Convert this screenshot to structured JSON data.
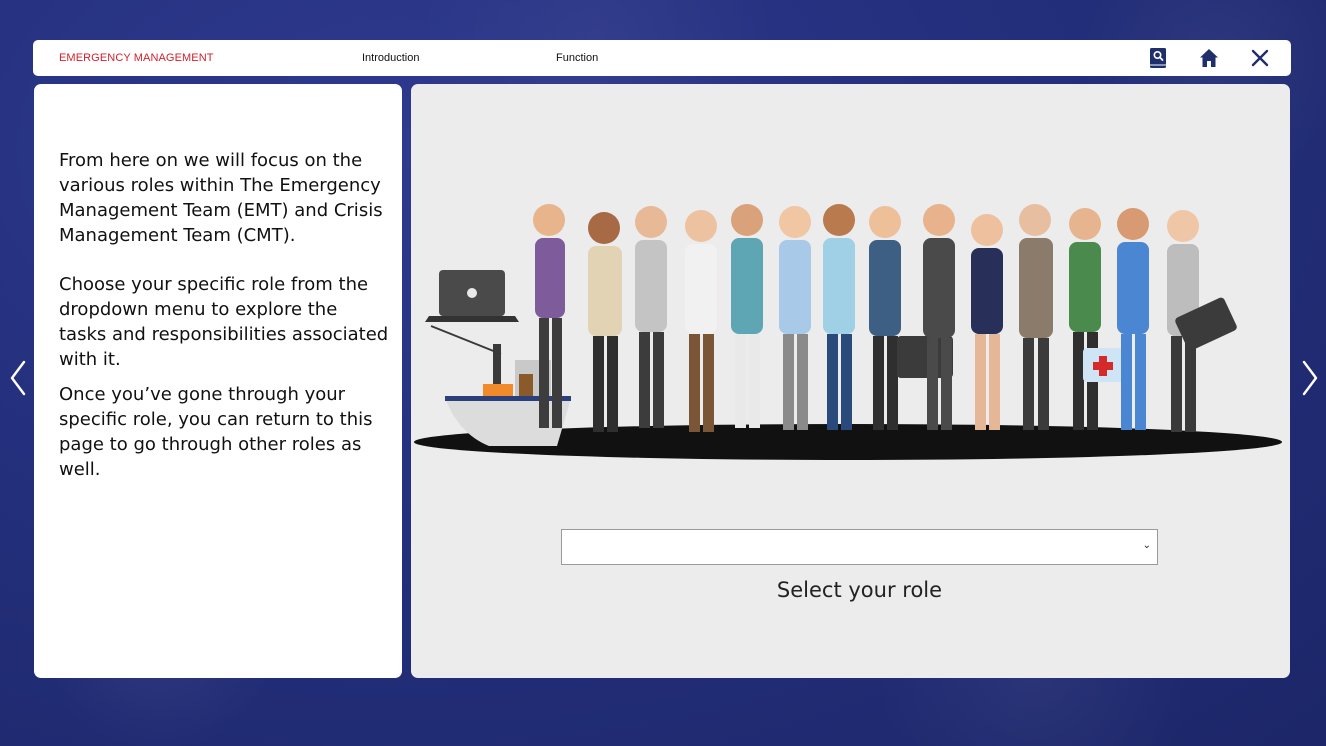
{
  "header": {
    "brand": "EMERGENCY MANAGEMENT",
    "nav": {
      "introduction": "Introduction",
      "function": "Function"
    },
    "icons": [
      "book-search-icon",
      "home-icon",
      "close-icon"
    ]
  },
  "left_panel": {
    "paragraph1": "From here on we will focus on the various roles within The Emergency Management Team (EMT) and Crisis Management Team (CMT).",
    "paragraph2": "Choose your specific role from the dropdown menu to explore the tasks and responsibilities associated with it.",
    "paragraph3": "Once you’ve gone through your specific role, you can return to this page to go through other roles as well."
  },
  "main_panel": {
    "role_select": {
      "selected_value": ""
    },
    "role_label": "Select your role"
  },
  "navigation": {
    "prev_icon": "chevron-left-icon",
    "next_icon": "chevron-right-icon"
  },
  "colors": {
    "accent": "#d21f2a",
    "background": "#24307d",
    "icon": "#1f2f6b"
  }
}
